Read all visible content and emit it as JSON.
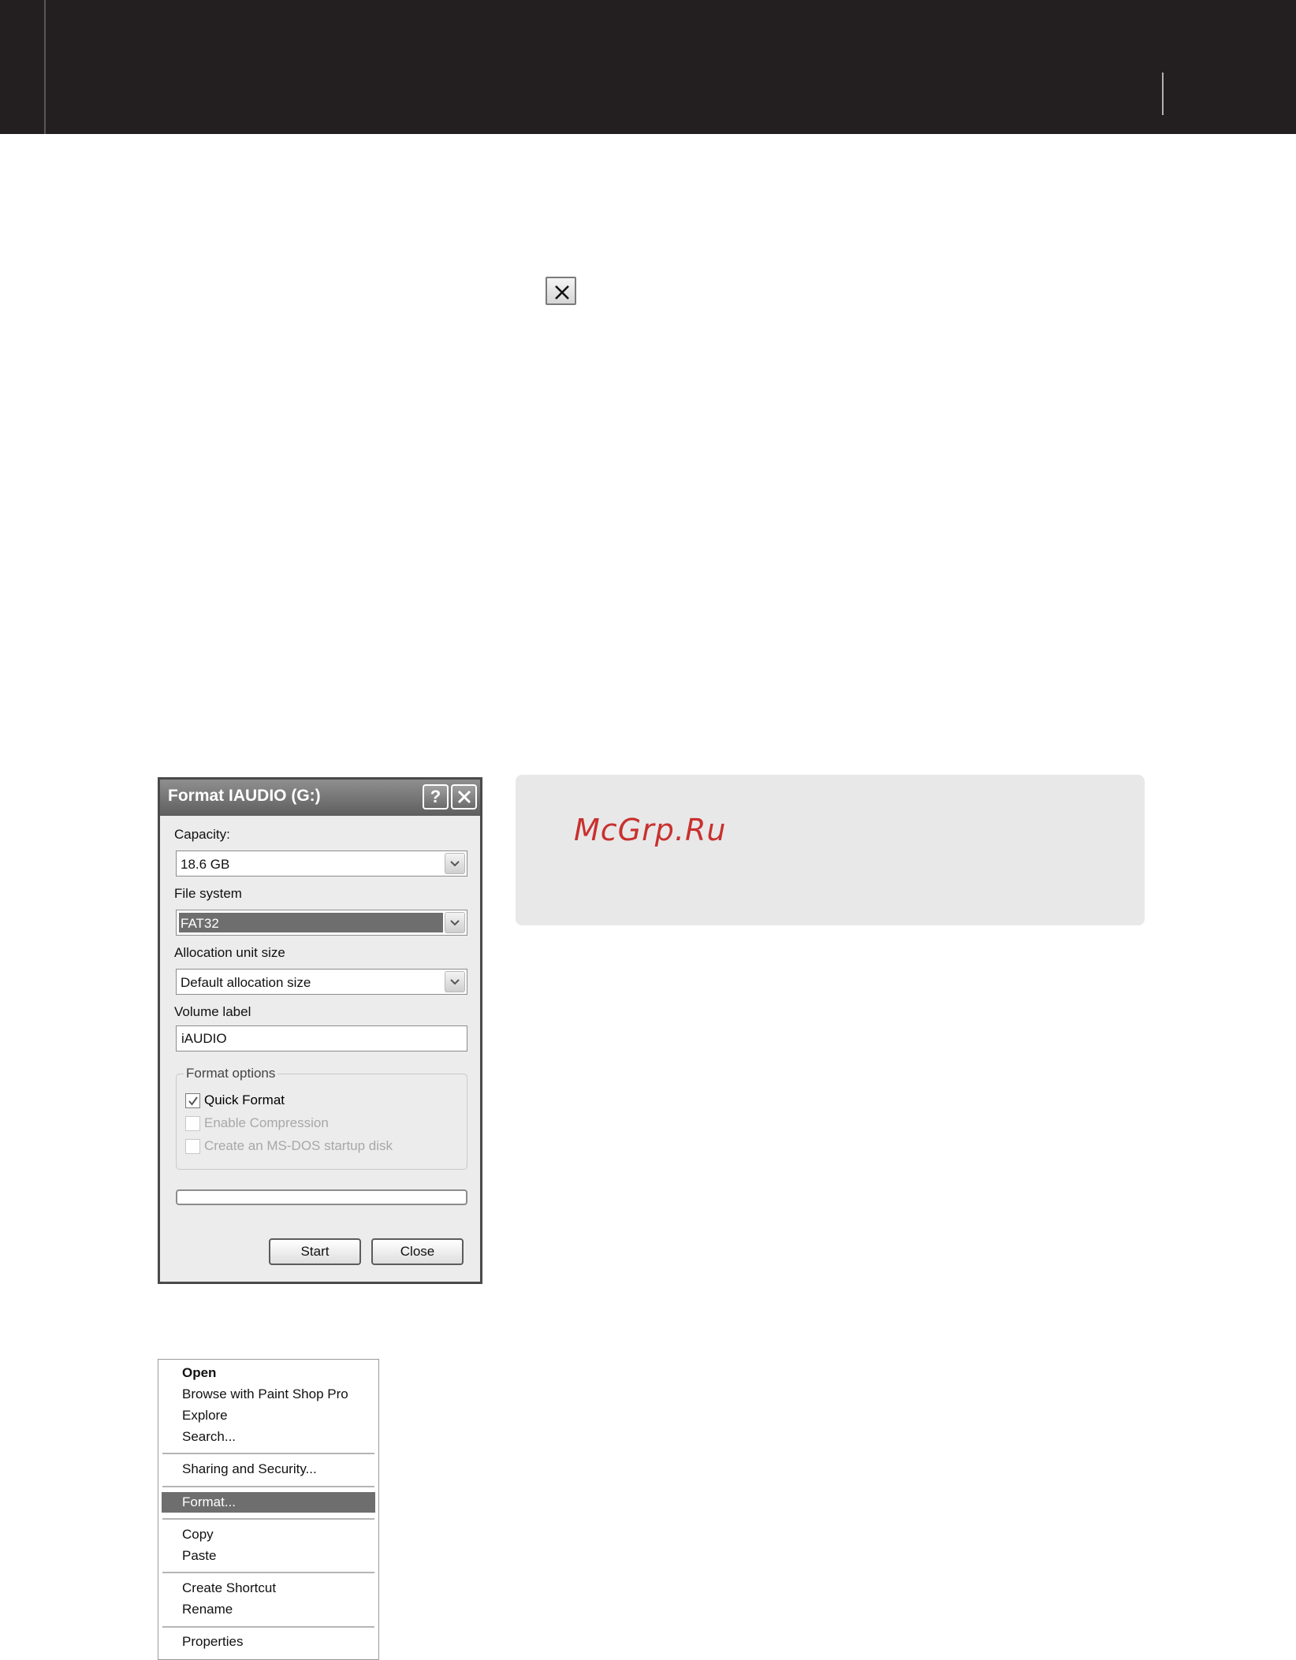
{
  "dialog": {
    "title": "Format IAUDIO (G:)",
    "help_label": "?",
    "capacity_label": "Capacity:",
    "capacity_value": "18.6 GB",
    "file_system_label": "File system",
    "file_system_value": "FAT32",
    "allocation_label": "Allocation unit size",
    "allocation_value": "Default allocation size",
    "volume_label_label": "Volume label",
    "volume_label_value": "iAUDIO",
    "format_options_label": "Format options",
    "options": [
      {
        "label": "Quick Format",
        "checked": true,
        "enabled": true
      },
      {
        "label": "Enable Compression",
        "checked": false,
        "enabled": false
      },
      {
        "label": "Create an MS-DOS startup disk",
        "checked": false,
        "enabled": false
      }
    ],
    "progress": 0,
    "start_label": "Start",
    "close_label": "Close"
  },
  "note": {
    "watermark": "McGrp.Ru"
  },
  "context_menu": {
    "items": [
      {
        "label": "Open",
        "bold": true
      },
      {
        "label": "Browse with Paint Shop Pro"
      },
      {
        "label": "Explore"
      },
      {
        "label": "Search..."
      },
      {
        "label": "Sharing and Security..."
      },
      {
        "label": "Format...",
        "selected": true
      },
      {
        "label": "Copy"
      },
      {
        "label": "Paste"
      },
      {
        "label": "Create Shortcut"
      },
      {
        "label": "Rename"
      },
      {
        "label": "Properties"
      }
    ]
  },
  "colors": {
    "top_band": "#231f20",
    "selection": "#6e6e6e",
    "note_background": "#e8e8e8",
    "watermark": "#c8312f"
  }
}
